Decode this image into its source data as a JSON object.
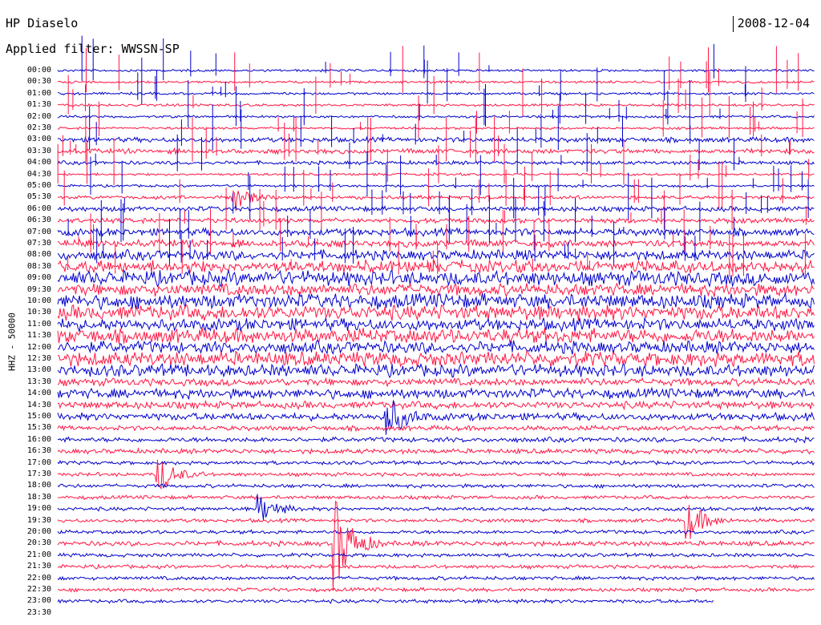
{
  "header": {
    "station": "HP Diaselo",
    "filter": "Applied filter: WWSSN-SP",
    "date": "2008-12-04"
  },
  "chart_data": {
    "type": "line",
    "title": "HP Diaselo",
    "subtitle": "Applied filter: WWSSN-SP",
    "date": "2008-12-04",
    "ylabel": "HHZ - 50000",
    "row_labels": [
      "00:00",
      "00:30",
      "01:00",
      "01:30",
      "02:00",
      "02:30",
      "03:00",
      "03:30",
      "04:00",
      "04:30",
      "05:00",
      "05:30",
      "06:00",
      "06:30",
      "07:00",
      "07:30",
      "08:00",
      "08:30",
      "09:00",
      "09:30",
      "10:00",
      "10:30",
      "11:00",
      "11:30",
      "12:00",
      "12:30",
      "13:00",
      "13:30",
      "14:00",
      "14:30",
      "15:00",
      "15:30",
      "16:00",
      "16:30",
      "17:00",
      "17:30",
      "18:00",
      "18:30",
      "19:00",
      "19:30",
      "20:00",
      "20:30",
      "21:00",
      "21:30",
      "22:00",
      "22:30",
      "23:00",
      "23:30"
    ],
    "row_noise_level": [
      1,
      1,
      1,
      1,
      1,
      1,
      2,
      2,
      1.5,
      1,
      1,
      1.5,
      2,
      2,
      3,
      3,
      4,
      5,
      6,
      5,
      6,
      6,
      5,
      6,
      5,
      6,
      5,
      3,
      4,
      3,
      3,
      2,
      2,
      2,
      1.5,
      1.5,
      1.5,
      1.5,
      1.5,
      1.5,
      1.5,
      2,
      1.5,
      1.5,
      1.5,
      1.5,
      1.5,
      0
    ],
    "colors": [
      "#0000cc",
      "#ff1744"
    ],
    "events": [
      {
        "time": "05:30",
        "minute": 7,
        "amplitude": 3
      },
      {
        "time": "15:00",
        "minute": 13,
        "amplitude": 5
      },
      {
        "time": "17:30",
        "minute": 4,
        "amplitude": 4
      },
      {
        "time": "19:00",
        "minute": 8,
        "amplitude": 3
      },
      {
        "time": "19:30",
        "minute": 25,
        "amplitude": 4
      },
      {
        "time": "20:30",
        "minute": 11,
        "amplitude": 10
      }
    ],
    "last_trace_end_minute": 26,
    "grid": false
  }
}
